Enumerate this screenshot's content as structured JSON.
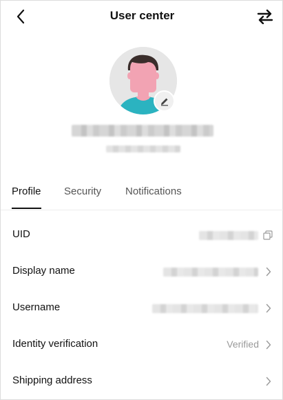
{
  "header": {
    "title": "User center",
    "back_icon": "back-arrow-icon",
    "switch_icon": "swap-arrows-icon"
  },
  "profile": {
    "avatar_icon": "user-avatar-icon",
    "edit_icon": "pencil-icon"
  },
  "tabs": [
    {
      "label": "Profile",
      "active": true
    },
    {
      "label": "Security",
      "active": false
    },
    {
      "label": "Notifications",
      "active": false
    }
  ],
  "rows": [
    {
      "label": "UID",
      "value": "",
      "action_icon": "copy-icon"
    },
    {
      "label": "Display name",
      "value": "",
      "action_icon": "chevron-right-icon"
    },
    {
      "label": "Username",
      "value": "",
      "action_icon": "chevron-right-icon"
    },
    {
      "label": "Identity verification",
      "value": "Verified",
      "action_icon": "chevron-right-icon"
    },
    {
      "label": "Shipping address",
      "value": "",
      "action_icon": "chevron-right-icon"
    }
  ],
  "colors": {
    "avatar_bg": "#e6e6e6",
    "skin": "#f2a3b3",
    "hair": "#3a2d2b",
    "shirt": "#2bb3c0",
    "muted_text": "#999999"
  }
}
